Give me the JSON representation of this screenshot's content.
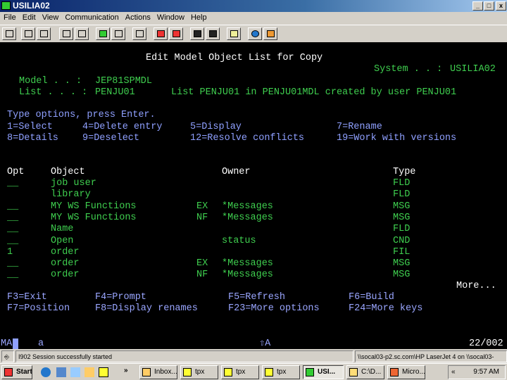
{
  "window": {
    "title": "USILIA02",
    "min": "_",
    "max": "□",
    "close": "x"
  },
  "menu": [
    "File",
    "Edit",
    "View",
    "Communication",
    "Actions",
    "Window",
    "Help"
  ],
  "screen": {
    "title": "Edit Model Object List for Copy",
    "system_label": "System . . :",
    "system_value": "USILIA02",
    "model_label": "Model . . :",
    "model_value": "JEP81SPMDL",
    "list_label": "List . . . :",
    "list_value": "PENJU01",
    "list_desc": "List PENJU01 in PENJU01MDL created by user PENJU01",
    "instructions": "Type options, press Enter.",
    "options": [
      "1=Select",
      "4=Delete entry",
      "5=Display",
      "7=Rename",
      "8=Details",
      "9=Deselect",
      "12=Resolve conflicts",
      "19=Work with versions"
    ],
    "headers": {
      "opt": "Opt",
      "object": "Object",
      "owner": "Owner",
      "type": "Type"
    },
    "rows": [
      {
        "opt": "__",
        "object": "job user",
        "qual": "",
        "owner": "",
        "type": "FLD"
      },
      {
        "opt": "",
        "object": "library",
        "qual": "",
        "owner": "",
        "type": "FLD"
      },
      {
        "opt": "__",
        "object": "MY WS Functions",
        "qual": "EX",
        "owner": "*Messages",
        "type": "MSG"
      },
      {
        "opt": "__",
        "object": "MY WS Functions",
        "qual": "NF",
        "owner": "*Messages",
        "type": "MSG"
      },
      {
        "opt": "__",
        "object": "Name",
        "qual": "",
        "owner": "",
        "type": "FLD"
      },
      {
        "opt": "__",
        "object": "Open",
        "qual": "",
        "owner": "status",
        "type": "CND"
      },
      {
        "opt": "1",
        "object": "order",
        "qual": "",
        "owner": "",
        "type": "FIL"
      },
      {
        "opt": "__",
        "object": "order",
        "qual": "EX",
        "owner": "*Messages",
        "type": "MSG"
      },
      {
        "opt": "__",
        "object": "order",
        "qual": "NF",
        "owner": "*Messages",
        "type": "MSG"
      }
    ],
    "more": "More...",
    "fkeys": [
      "F3=Exit",
      "F4=Prompt",
      "F5=Refresh",
      "F6=Build",
      "F7=Position",
      "F8=Display renames",
      "F23=More options",
      "F24=More keys"
    ],
    "oia_left": "MA",
    "oia_a": "a",
    "oia_shift": "⇧A",
    "oia_pos": "22/002"
  },
  "status": {
    "message": "I902  Session successfully started",
    "printer": "\\\\socal03-p2.sc.com\\HP LaserJet 4 on \\\\socal03-"
  },
  "taskbar": {
    "start": "Start",
    "chevron": "»",
    "tasks": [
      "Inbox...",
      "tpx",
      "tpx",
      "tpx",
      "USI...",
      "C:\\D...",
      "Micro..."
    ],
    "tray_chevron": "«",
    "clock": "9:57 AM"
  }
}
